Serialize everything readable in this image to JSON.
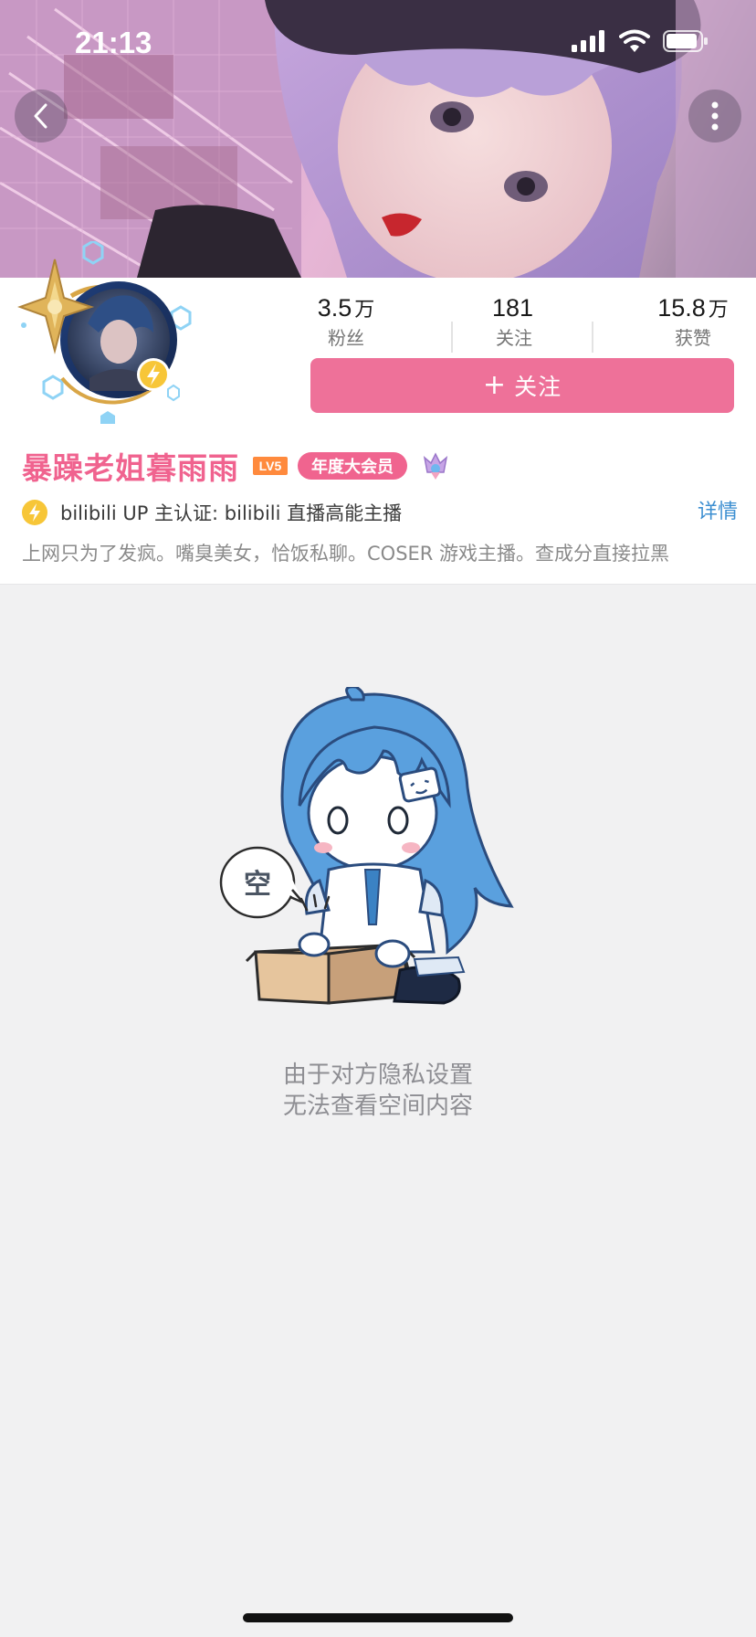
{
  "status_bar": {
    "time": "21:13"
  },
  "navigation": {
    "back_icon": "chevron-left-icon",
    "more_icon": "more-vertical-icon"
  },
  "profile": {
    "stats": [
      {
        "value": "3.5",
        "unit": "万",
        "label": "粉丝"
      },
      {
        "value": "181",
        "unit": "",
        "label": "关注"
      },
      {
        "value": "15.8",
        "unit": "万",
        "label": "获赞"
      }
    ],
    "follow_button": {
      "icon": "+",
      "label": "关注"
    },
    "name": "暴躁老姐暮雨雨",
    "level_badge": "LV5",
    "vip_badge": "年度大会员",
    "certification": {
      "text": "bilibili UP 主认证: bilibili 直播高能主播",
      "detail_link": "详情"
    },
    "bio": "上网只为了发疯。嘴臭美女，恰饭私聊。COSER 游戏主播。查成分直接拉黑"
  },
  "empty_state": {
    "bubble_text": "空",
    "line1": "由于对方隐私设置",
    "line2": "无法查看空间内容"
  },
  "colors": {
    "accent": "#ee7199",
    "name_pink": "#f0638f",
    "link_blue": "#3d8fd1",
    "background": "#f1f1f2"
  }
}
